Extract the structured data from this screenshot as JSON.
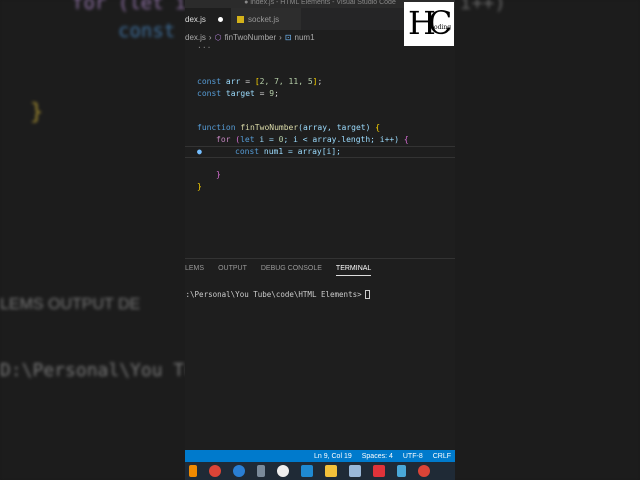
{
  "window_title": "● index.js - HTML Elements - Visual Studio Code",
  "tabs": [
    {
      "label": "dex.js",
      "modified": true
    },
    {
      "label": "socket.js"
    }
  ],
  "breadcrumb": {
    "file": "dex.js",
    "function": "finTwoNumber",
    "variable": "num1"
  },
  "folded": "...",
  "code": {
    "l1": {
      "kw": "const",
      "v": "arr",
      "eq": " = ",
      "open": "[",
      "vals": "2, 7, 11, 5",
      "close": "]",
      "end": ";"
    },
    "l2": {
      "kw": "const",
      "v": "target",
      "eq": " = ",
      "val": "9",
      "end": ";"
    },
    "l3": {
      "kw": "function",
      "fn": "finTwoNumber",
      "args": "(array, target) ",
      "brace": "{"
    },
    "l4": {
      "kw": "for",
      "rest1": " (",
      "kw2": "let",
      "rest2": " i = ",
      "zero": "0",
      "rest3": "; i < array.length; i++) ",
      "brace": "{"
    },
    "l5": {
      "kw": "const",
      "v": "num1",
      "rest": " = array[i];"
    },
    "l6": "}",
    "l7": "}"
  },
  "panel": {
    "tabs": [
      "LEMS",
      "OUTPUT",
      "DEBUG CONSOLE",
      "TERMINAL"
    ],
    "prompt": "D:\\Personal\\You Tube\\code\\HTML Elements>"
  },
  "status": {
    "position": "Ln 9, Col 19",
    "spaces": "Spaces: 4",
    "encoding": "UTF-8",
    "eol": "CRLF"
  },
  "logo": {
    "text": "HC",
    "sub": "oding"
  },
  "background": {
    "line1": "for (let i",
    "line1r": "i++)",
    "line2": "const",
    "line3": "LEMS    OUTPUT    DE",
    "line4": "D:\\Personal\\You Tu"
  },
  "taskbar_icons": [
    "vlc",
    "chrome",
    "thunderbird",
    "calculator",
    "greenshot",
    "vscode",
    "explorer",
    "photos",
    "anydesk",
    "notepad",
    "chrome-alt"
  ]
}
